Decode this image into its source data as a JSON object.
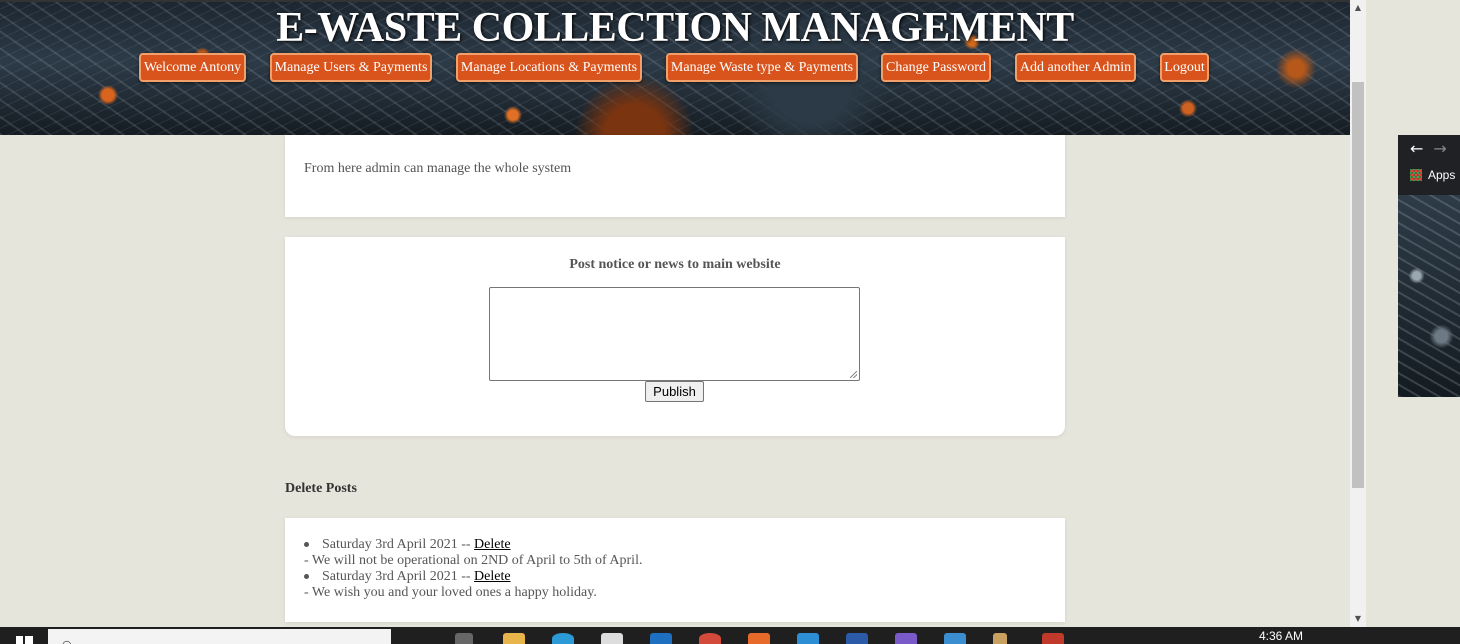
{
  "header": {
    "title": "E-WASTE COLLECTION MANAGEMENT",
    "nav": [
      {
        "label": "Welcome Antony"
      },
      {
        "label": "Manage Users & Payments"
      },
      {
        "label": "Manage Locations & Payments"
      },
      {
        "label": "Manage Waste type & Payments"
      },
      {
        "label": "Change Password"
      },
      {
        "label": "Add another Admin"
      },
      {
        "label": "Logout"
      }
    ]
  },
  "intro": {
    "text": "From here admin can manage the whole system"
  },
  "post_notice": {
    "heading": "Post notice or news to main website",
    "textarea_value": "",
    "publish_label": "Publish"
  },
  "delete_posts": {
    "heading": "Delete Posts",
    "posts": [
      {
        "date": "Saturday 3rd April 2021 --",
        "delete_label": "Delete",
        "content": "- We will not be operational on 2ND of April to 5th of April."
      },
      {
        "date": "Saturday 3rd April 2021 --",
        "delete_label": "Delete",
        "content": "- We wish you and your loved ones a happy holiday."
      }
    ]
  },
  "side_window": {
    "apps_label": "Apps"
  },
  "taskbar": {
    "clock": "4:36 AM"
  },
  "colors": {
    "accent": "#d9541c",
    "page_bg": "#e5e5dc"
  }
}
